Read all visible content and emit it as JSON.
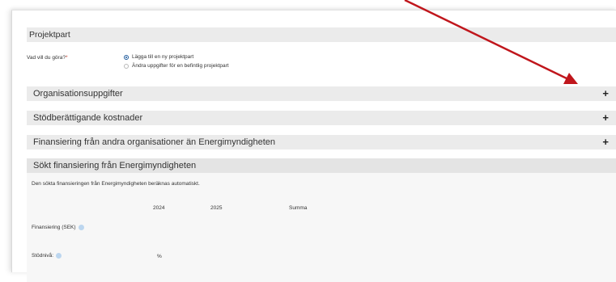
{
  "colors": {
    "section_bar": "#ebebeb",
    "arrow": "#c0161c",
    "radio_selected": "#1e5a9c",
    "info_icon": "#bcd6ef",
    "required_mark": "#c0392b"
  },
  "header": {
    "title": "Projektpart"
  },
  "action": {
    "label": "Vad vill du göra?",
    "required_mark": "*",
    "options": [
      {
        "label": "Lägga till en ny projektpart",
        "selected": true
      },
      {
        "label": "Ändra uppgifter för en befintlig projektpart",
        "selected": false
      }
    ]
  },
  "sections": [
    {
      "title": "Organisationsuppgifter",
      "toggle": "+"
    },
    {
      "title": "Stödberättigande kostnader",
      "toggle": "+"
    },
    {
      "title": "Finansiering från andra organisationer än Energimyndigheten",
      "toggle": "+"
    }
  ],
  "sought": {
    "title": "Sökt finansiering från Energimyndigheten",
    "description": "Den sökta finansieringen från Energimyndigheten beräknas automatiskt.",
    "columns": [
      "2024",
      "2025",
      "Summa"
    ],
    "financing_label": "Finansiering (SEK)",
    "support_level_label": "Stödnivå:",
    "support_level_unit": "%"
  }
}
